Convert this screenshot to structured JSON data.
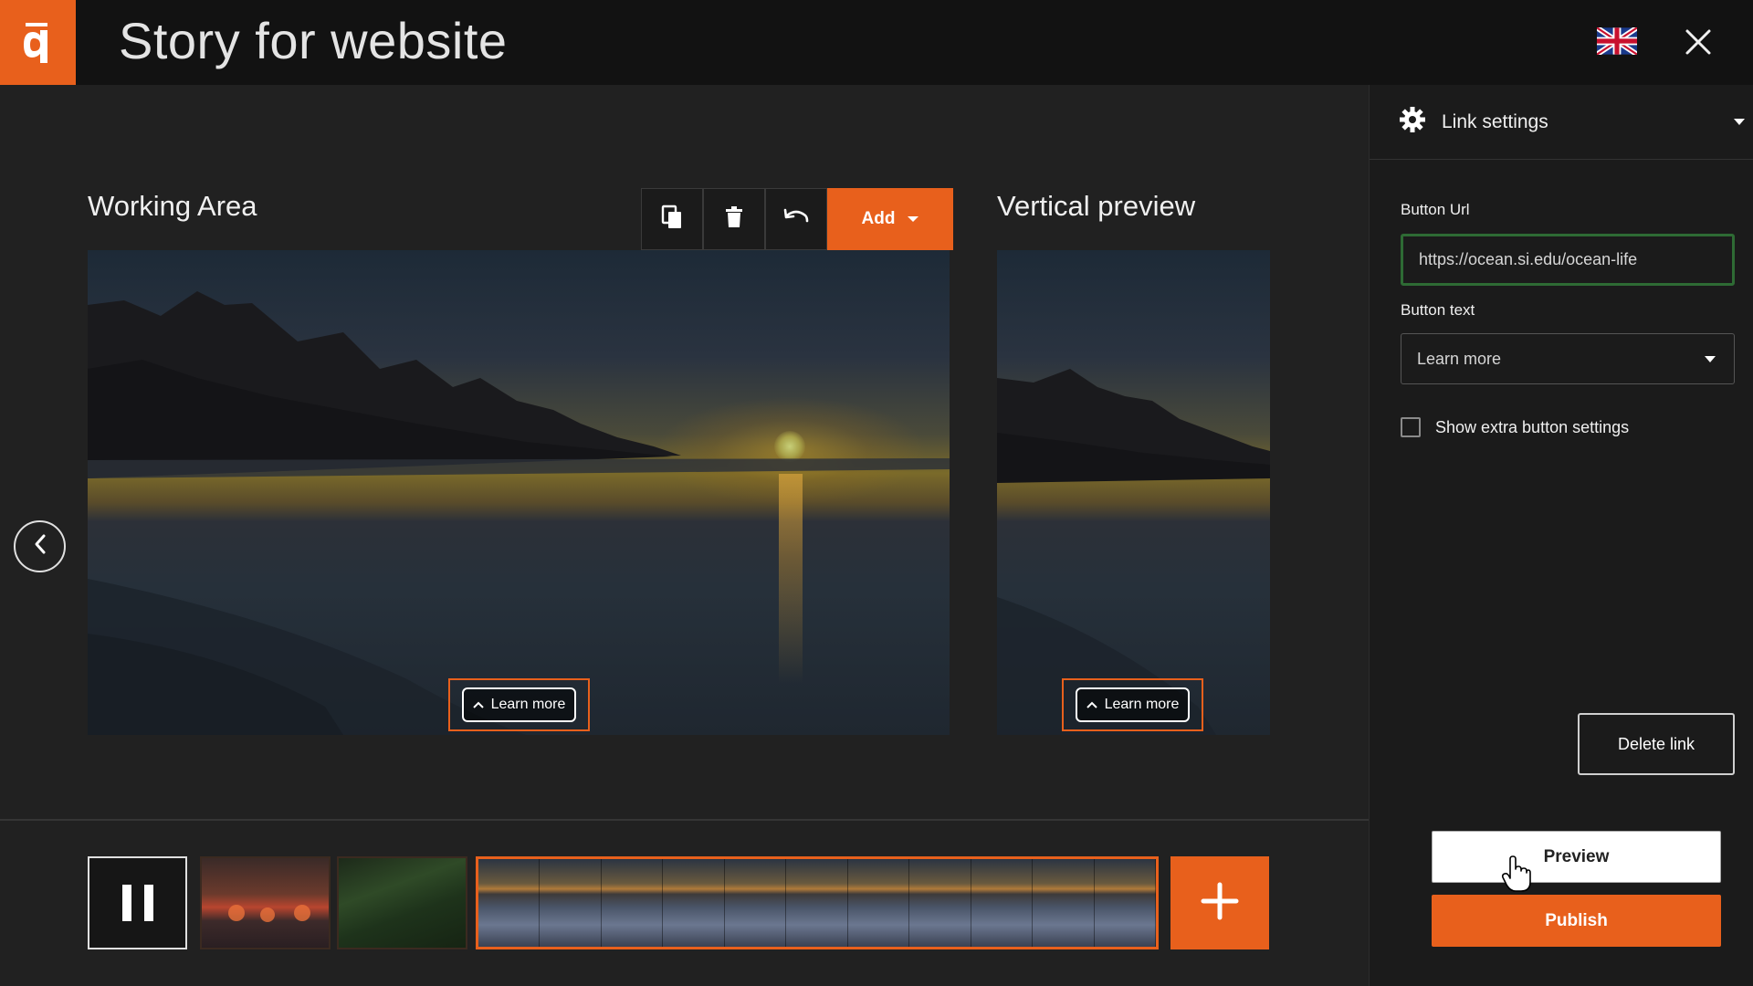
{
  "header": {
    "title": "Story for website",
    "logo_icon": "q-logo-icon",
    "language_icon": "uk-flag-icon",
    "close_icon": "close-icon"
  },
  "workspace": {
    "working_area_title": "Working Area",
    "vertical_preview_title": "Vertical preview",
    "toolbar": {
      "duplicate_icon": "copy-icon",
      "delete_icon": "trash-icon",
      "undo_icon": "undo-icon",
      "add_label": "Add"
    },
    "cta_button_label": "Learn more",
    "nav_prev_icon": "chevron-left-icon"
  },
  "timeline": {
    "pause_icon": "pause-icon",
    "add_icon": "plus-icon",
    "clips": [
      "sunset-clip",
      "forest-clip",
      "ocean-clip"
    ]
  },
  "panel": {
    "section_title": "Link settings",
    "section_icon": "gear-icon",
    "button_url_label": "Button Url",
    "button_url_value": "https://ocean.si.edu/ocean-life",
    "button_text_label": "Button text",
    "button_text_value": "Learn more",
    "extra_settings_label": "Show extra button settings",
    "extra_settings_checked": false,
    "delete_link_label": "Delete link",
    "preview_label": "Preview",
    "publish_label": "Publish"
  },
  "colors": {
    "accent": "#e8601c",
    "background": "#212121",
    "header": "#121212",
    "input_focus": "#2e6b34"
  }
}
